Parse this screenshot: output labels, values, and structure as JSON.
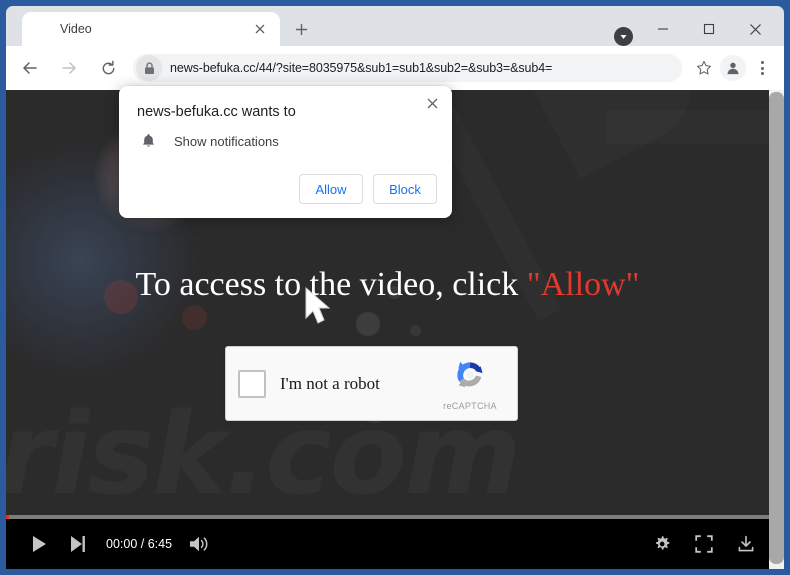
{
  "browser": {
    "tab": {
      "title": "Video",
      "close_icon": "close-icon"
    },
    "new_tab_label": "+",
    "download_indicator_icon": "download-arrow-icon",
    "window_controls": {
      "minimize": "minimize-icon",
      "maximize": "maximize-icon",
      "close": "close-icon"
    },
    "toolbar": {
      "back_icon": "arrow-left-icon",
      "forward_icon": "arrow-right-icon",
      "reload_icon": "reload-icon",
      "lock_icon": "lock-icon",
      "url": "news-befuka.cc/44/?site=8035975&sub1=sub1&sub2=&sub3=&sub4=",
      "bookmark_icon": "star-icon",
      "profile_icon": "person-avatar-icon",
      "menu_icon": "three-dots-menu-icon"
    }
  },
  "permission_dialog": {
    "title": "news-befuka.cc wants to",
    "permission_icon": "bell-icon",
    "permission_label": "Show notifications",
    "allow_label": "Allow",
    "block_label": "Block",
    "close_icon": "close-icon"
  },
  "page": {
    "headline_prefix": "To access to the video, click ",
    "headline_highlight": "\"Allow\"",
    "highlight_color": "#e03a2f",
    "watermark_text": "risk.com",
    "cursor_icon": "mouse-pointer-icon",
    "recaptcha": {
      "checkbox_name": "im-not-a-robot-checkbox",
      "label": "I'm not a robot",
      "brand_text": "reCAPTCHA",
      "logo_icon": "recaptcha-logo-icon"
    },
    "player": {
      "play_icon": "play-icon",
      "next_icon": "next-track-icon",
      "timestamp": "00:00 / 6:45",
      "current_time": "00:00",
      "duration": "6:45",
      "volume_icon": "volume-high-icon",
      "settings_icon": "gear-icon",
      "fullscreen_icon": "fullscreen-icon",
      "download_icon": "download-icon",
      "progress_percent": 0
    }
  }
}
